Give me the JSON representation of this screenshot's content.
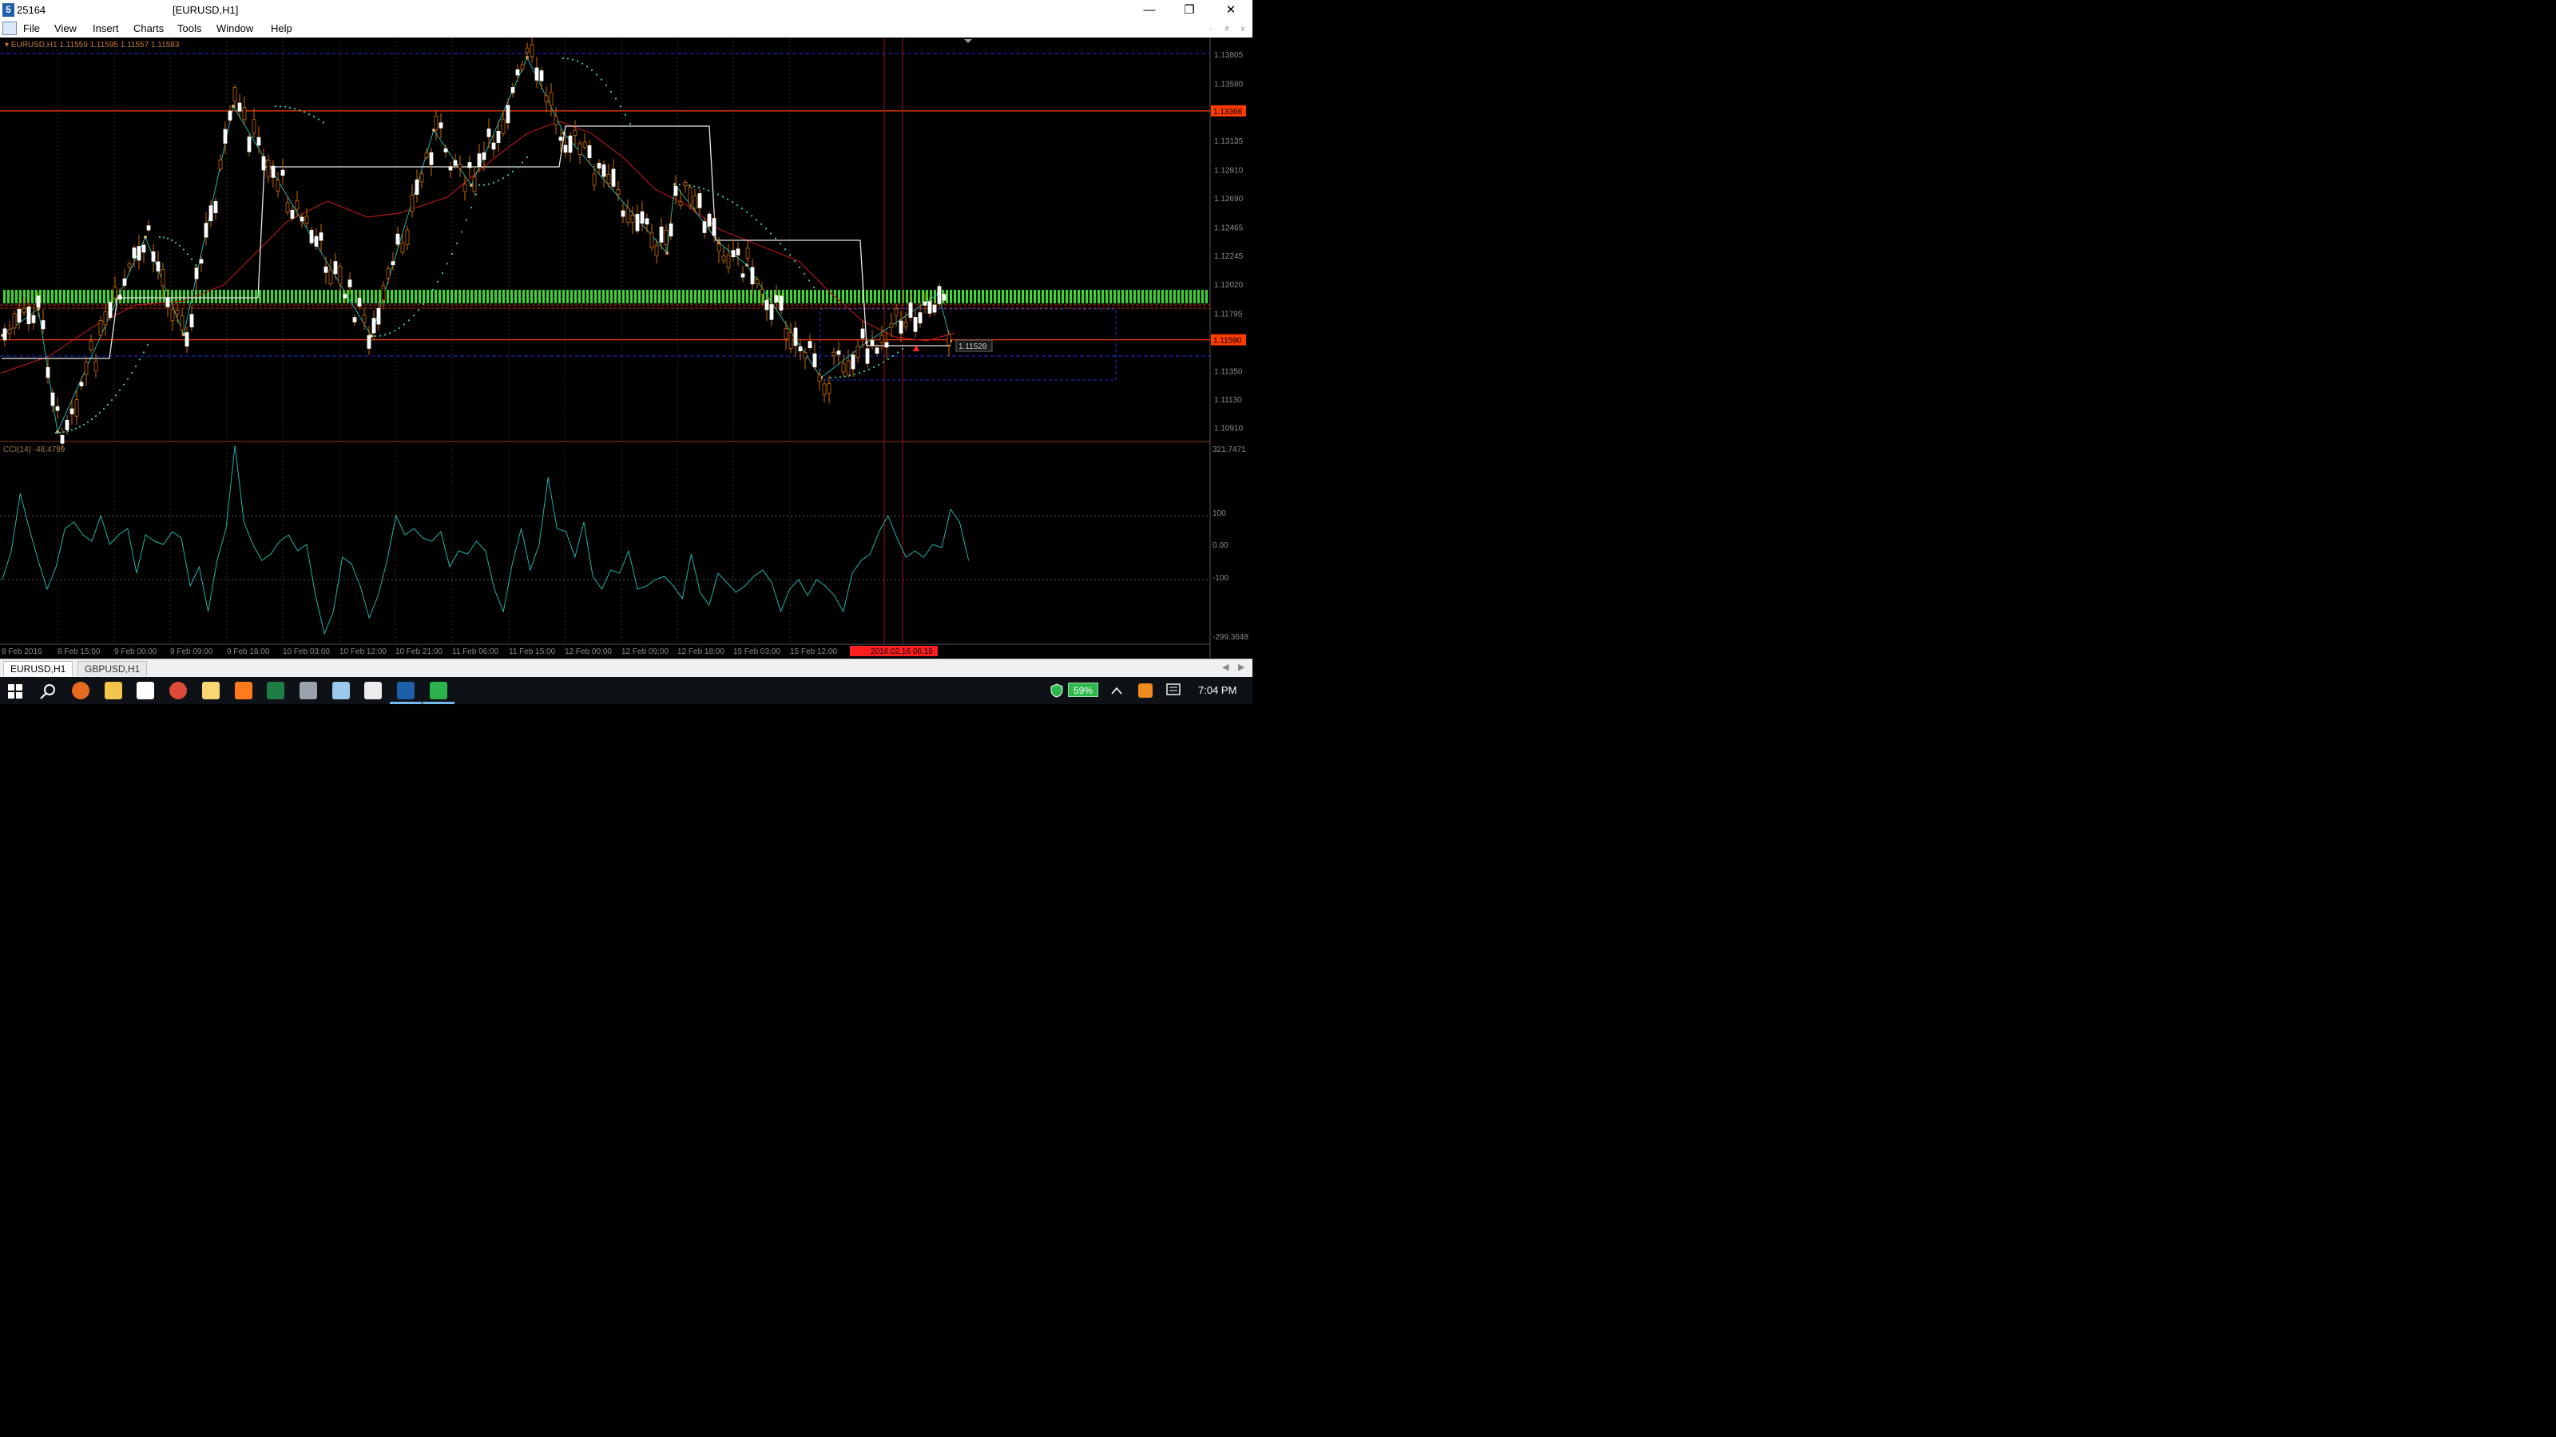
{
  "window": {
    "app_id": "25164",
    "title": "[EURUSD,H1]"
  },
  "menu": [
    "File",
    "View",
    "Insert",
    "Charts",
    "Tools",
    "Window",
    "Help"
  ],
  "chart": {
    "header": "EURUSD,H1  1.11559 1.11595 1.11557 1.11583",
    "indicator_label": "CCI(14) -48.4799",
    "hover_price": "1.11528",
    "price_axis": [
      "1.13805",
      "1.13580",
      "1.13135",
      "1.12910",
      "1.12690",
      "1.12465",
      "1.12245",
      "1.12020",
      "1.11795",
      "1.11350",
      "1.11130",
      "1.10910"
    ],
    "price_tags": [
      {
        "value": "1.13366",
        "color": "#ff3b00"
      },
      {
        "value": "1.11590",
        "color": "#ff3b00"
      }
    ],
    "cci_axis": [
      "321.7471",
      "100",
      "0.00",
      "-100",
      "-299.3648"
    ],
    "time_axis": [
      "8 Feb 2016",
      "8 Feb 15:00",
      "9 Feb 00:00",
      "9 Feb 09:00",
      "9 Feb 18:00",
      "10 Feb 03:00",
      "10 Feb 12:00",
      "10 Feb 21:00",
      "11 Feb 06:00",
      "11 Feb 15:00",
      "12 Feb 00:00",
      "12 Feb 09:00",
      "12 Feb 18:00",
      "15 Feb 03:00",
      "15 Feb 12:00"
    ],
    "time_cursor_label": "2016.02.16 06:15",
    "colors": {
      "bull_candle": "#ffffff",
      "bear_candle": "#ffffff",
      "wick": "#cc6a00",
      "zigzag": "#20b2aa",
      "sar": "#3ec7b0",
      "ma": "#b01818",
      "green_bars": "#39d82f",
      "level_line": "#ff3b00"
    }
  },
  "tabs": [
    {
      "label": "EURUSD,H1",
      "active": true
    },
    {
      "label": "GBPUSD,H1",
      "active": false
    }
  ],
  "taskbar": {
    "battery": "59%",
    "clock": "7:04 PM"
  }
}
